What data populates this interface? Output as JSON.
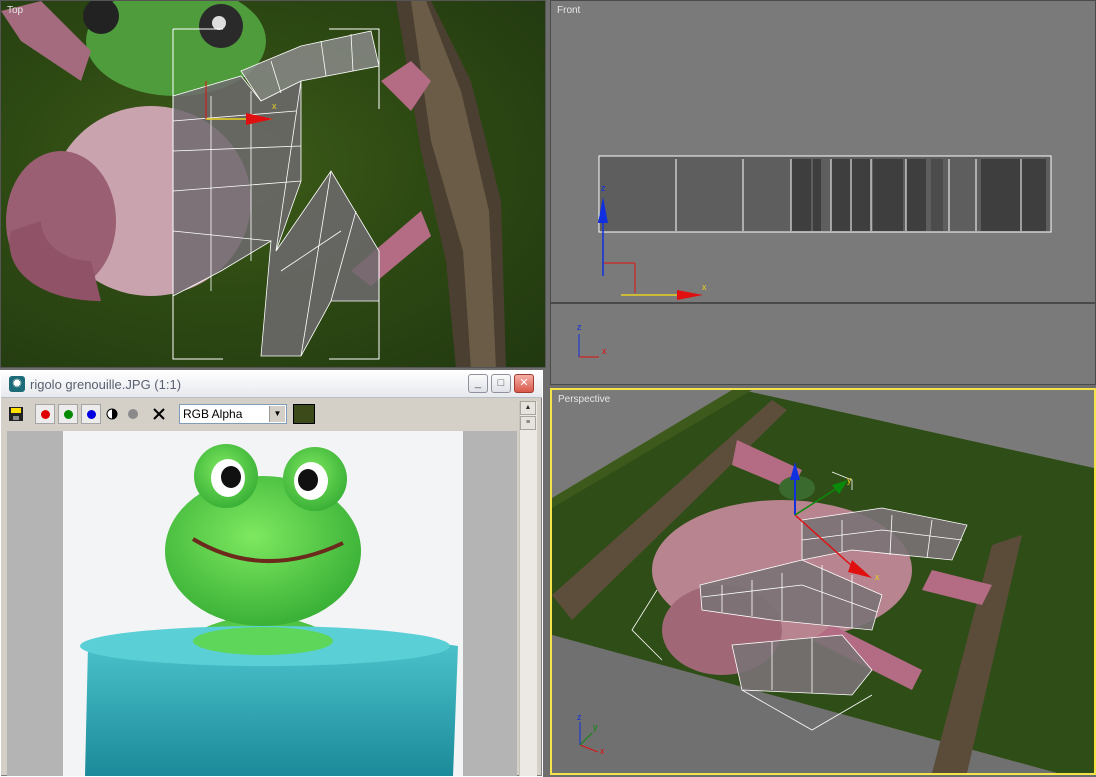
{
  "viewports": {
    "top": {
      "label": "Top"
    },
    "front": {
      "label": "Front",
      "axis_x": "x",
      "axis_z": "z",
      "small_axis_x": "x",
      "small_axis_z": "z"
    },
    "perspective": {
      "label": "Perspective",
      "axis_x": "x",
      "axis_y": "y",
      "axis_z": "z"
    }
  },
  "image_window": {
    "title": "rigolo grenouille.JPG (1:1)",
    "minimize_glyph": "_",
    "maximize_glyph": "□",
    "close_glyph": "✕",
    "channel_select": "RGB Alpha",
    "channel_options": [
      "RGB Alpha"
    ],
    "swatch_color": "#3b4a18",
    "channel_colors": {
      "red": "#e00000",
      "green": "#008a00",
      "blue": "#0000e0"
    }
  },
  "colors": {
    "active_viewport_border": "#f4e44a",
    "axis_x": "#e01010",
    "axis_y": "#e8d020",
    "axis_z": "#1030e0"
  },
  "icons": [
    "save-icon",
    "red-channel-icon",
    "green-channel-icon",
    "blue-channel-icon",
    "mono-icon",
    "alpha-icon",
    "clear-icon",
    "app-icon"
  ]
}
